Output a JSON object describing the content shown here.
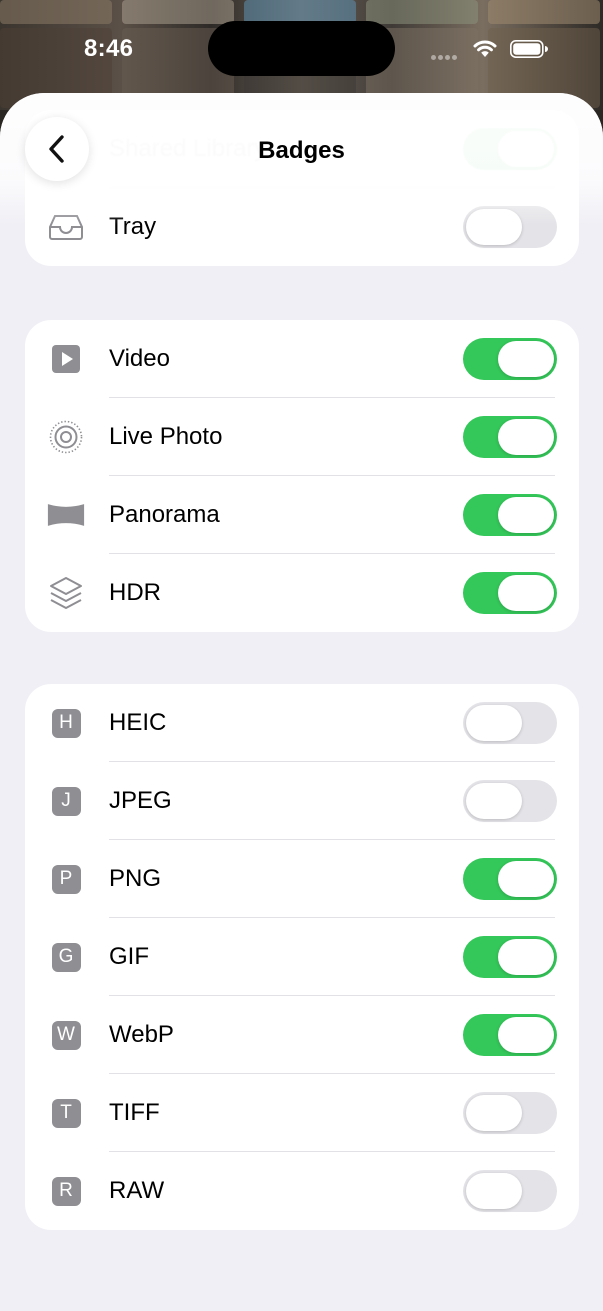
{
  "status_bar": {
    "time": "8:46"
  },
  "nav": {
    "title": "Badges"
  },
  "group1": [
    {
      "label": "Shared Library",
      "icon": "photo-library-icon",
      "on": true
    },
    {
      "label": "Tray",
      "icon": "tray-icon",
      "on": false
    }
  ],
  "group2": [
    {
      "label": "Video",
      "icon": "video-play-icon",
      "on": true
    },
    {
      "label": "Live Photo",
      "icon": "live-photo-icon",
      "on": true
    },
    {
      "label": "Panorama",
      "icon": "panorama-icon",
      "on": true
    },
    {
      "label": "HDR",
      "icon": "hdr-layers-icon",
      "on": true
    }
  ],
  "group3": [
    {
      "label": "HEIC",
      "badge": "H",
      "on": false
    },
    {
      "label": "JPEG",
      "badge": "J",
      "on": false
    },
    {
      "label": "PNG",
      "badge": "P",
      "on": true
    },
    {
      "label": "GIF",
      "badge": "G",
      "on": true
    },
    {
      "label": "WebP",
      "badge": "W",
      "on": true
    },
    {
      "label": "TIFF",
      "badge": "T",
      "on": false
    },
    {
      "label": "RAW",
      "badge": "R",
      "on": false
    }
  ],
  "colors": {
    "toggle_on": "#34c759",
    "toggle_off": "#e4e4e8",
    "badge_gray": "#8e8e93",
    "background": "#f0eff5"
  }
}
